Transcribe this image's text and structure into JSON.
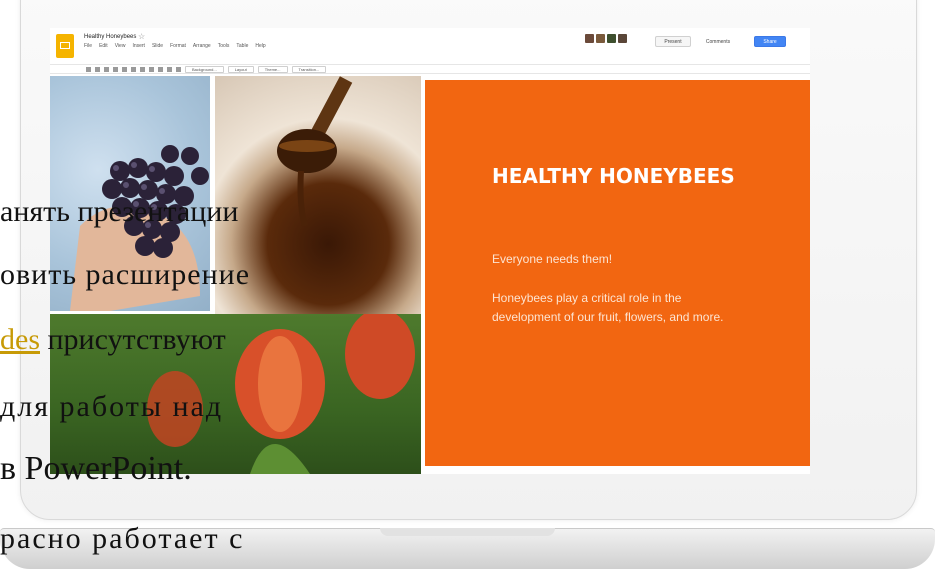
{
  "app": {
    "title": "Healthy Honeybees",
    "menu": [
      "File",
      "Edit",
      "View",
      "Insert",
      "Slide",
      "Format",
      "Arrange",
      "Tools",
      "Table",
      "Help"
    ],
    "toolbar_buttons": [
      "Background...",
      "Layout",
      "Theme...",
      "Transition..."
    ],
    "header_buttons": {
      "present": "Present",
      "comments": "Comments",
      "share": "Share"
    }
  },
  "slide": {
    "title": "HEALTHY HONEYBEES",
    "subtitle": "Everyone needs them!",
    "body": "Honeybees play a critical role in the development of our fruit, flowers, and more.",
    "panel_color": "#f26611"
  },
  "overlay": {
    "line1": "анять презентации",
    "line2": "овить  расширение",
    "line3_link": "des",
    "line3_rest": " присутствуют",
    "line4": "для  работы  над",
    "line5": "в  PowerPoint.",
    "line6": "расно  работает  с"
  },
  "colors": {
    "accent": "#f26611",
    "share": "#4285f4",
    "link": "#c79a06"
  }
}
